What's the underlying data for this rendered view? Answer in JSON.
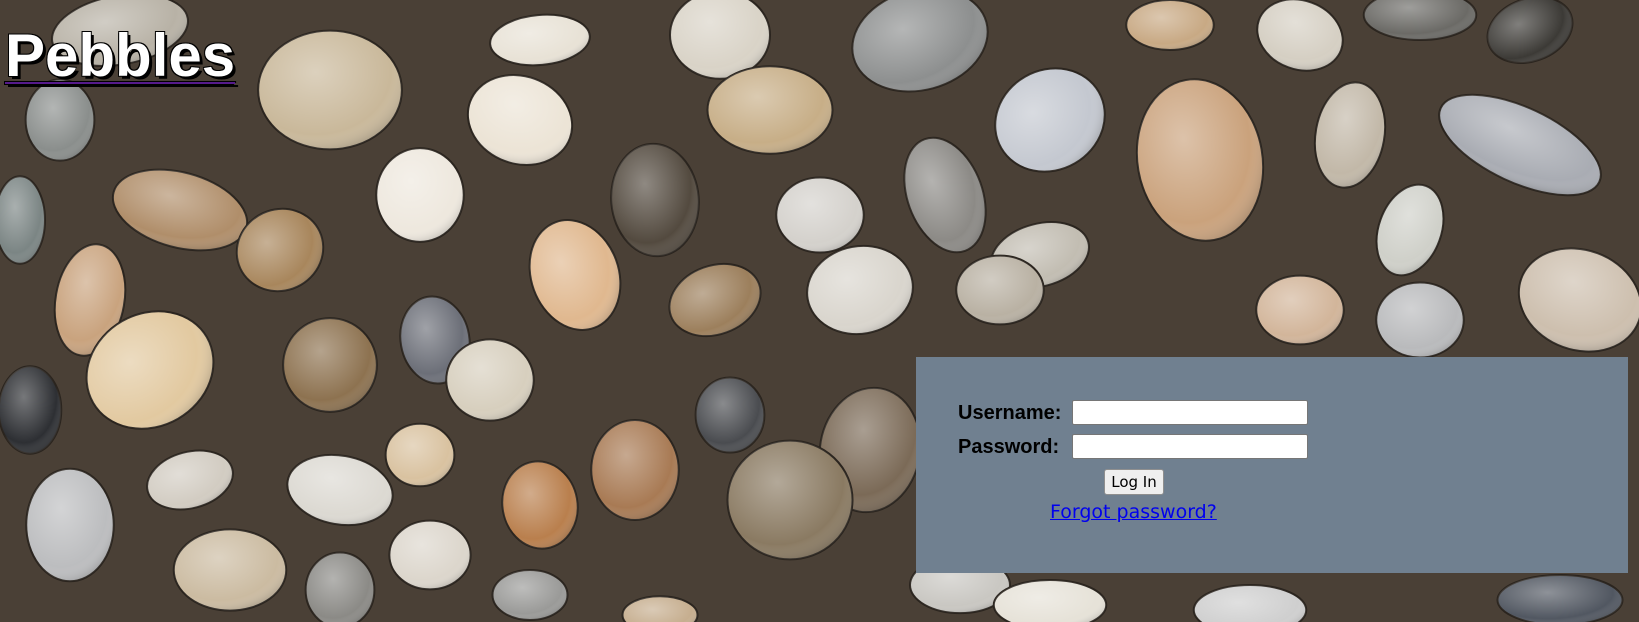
{
  "site": {
    "title": "Pebbles"
  },
  "background": {
    "description_icon": "pebbles-photo"
  },
  "login": {
    "username_label": "Username:",
    "username_value": "",
    "password_label": "Password:",
    "password_value": "",
    "login_button_label": "Log In",
    "forgot_password_label": "Forgot password?"
  },
  "colors": {
    "panel_background": "#708090",
    "link": "#0000ee",
    "title_text": "#ffffff"
  }
}
